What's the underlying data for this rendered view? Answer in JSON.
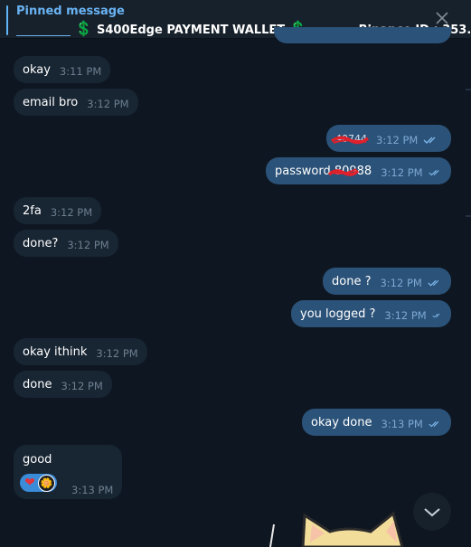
{
  "pinned": {
    "title": "Pinned message",
    "dollar": "💲",
    "wallet": "S400Edge PAYMENT WALLET",
    "binance": "Binance ID : 353..."
  },
  "messages": [
    {
      "side": "in",
      "text": "okay",
      "time": "3:11 PM"
    },
    {
      "side": "in",
      "text": "email bro",
      "time": "3:12 PM"
    },
    {
      "side": "out",
      "text": "40744",
      "time": "3:12 PM"
    },
    {
      "side": "out",
      "text": "password 80988",
      "time": "3:12 PM"
    },
    {
      "side": "in",
      "text": "2fa",
      "time": "3:12 PM"
    },
    {
      "side": "in",
      "text": "done?",
      "time": "3:12 PM"
    },
    {
      "side": "out",
      "text": "done ?",
      "time": "3:12 PM"
    },
    {
      "side": "out",
      "text": "you logged ?",
      "time": "3:12 PM"
    },
    {
      "side": "in",
      "text": "okay ithink",
      "time": "3:12 PM"
    },
    {
      "side": "in",
      "text": "done",
      "time": "3:12 PM"
    },
    {
      "side": "out",
      "text": "okay done",
      "time": "3:13 PM"
    },
    {
      "side": "in",
      "text": "good",
      "time": "3:13 PM"
    }
  ],
  "reactions": {
    "heart": "❤",
    "avatar": "🌼"
  },
  "colors": {
    "incoming": "#182533",
    "outgoing": "#2b5278",
    "background": "#0e1621",
    "accent": "#6ab3f3"
  },
  "icons": {
    "close": "close-icon",
    "ticks": "double-check-icon",
    "scroll_down": "chevron-down-icon",
    "sticker": "cat-sticker"
  }
}
